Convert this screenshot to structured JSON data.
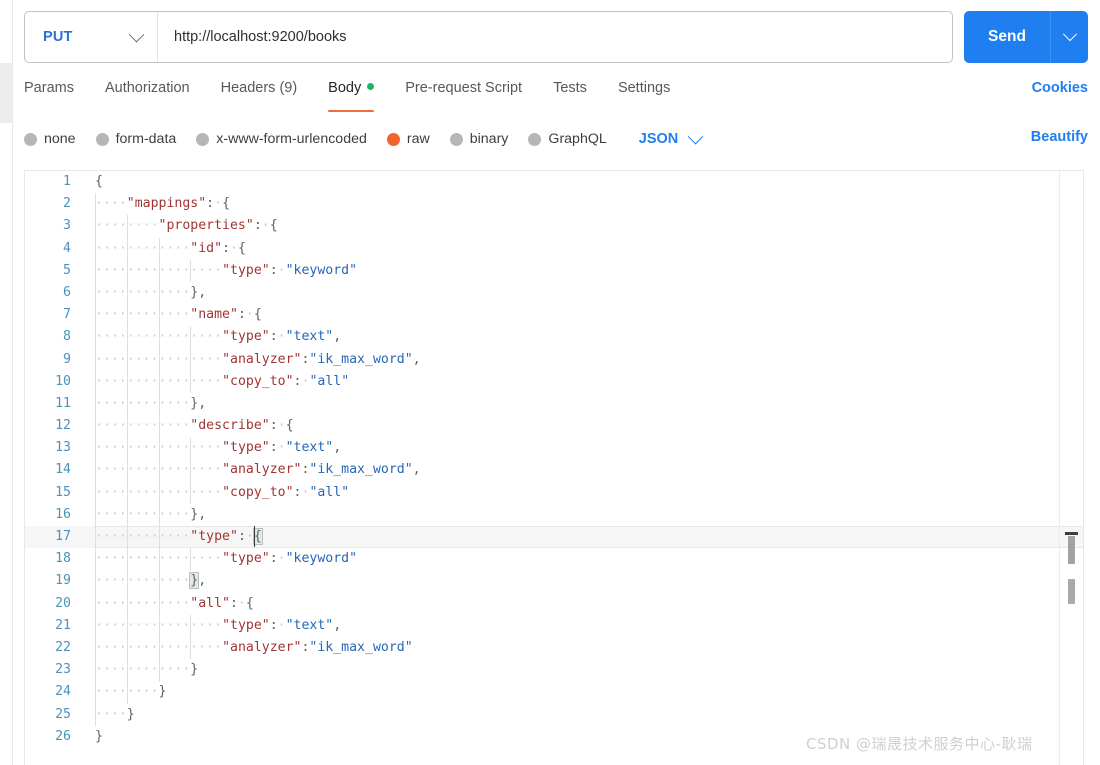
{
  "request": {
    "method": "PUT",
    "url": "http://localhost:9200/books",
    "send_label": "Send"
  },
  "tabs": [
    {
      "label": "Params",
      "active": false,
      "dot": false
    },
    {
      "label": "Authorization",
      "active": false,
      "dot": false
    },
    {
      "label": "Headers (9)",
      "active": false,
      "dot": false
    },
    {
      "label": "Body",
      "active": true,
      "dot": true
    },
    {
      "label": "Pre-request Script",
      "active": false,
      "dot": false
    },
    {
      "label": "Tests",
      "active": false,
      "dot": false
    },
    {
      "label": "Settings",
      "active": false,
      "dot": false
    }
  ],
  "cookies_label": "Cookies",
  "body_types": [
    {
      "label": "none",
      "selected": false
    },
    {
      "label": "form-data",
      "selected": false
    },
    {
      "label": "x-www-form-urlencoded",
      "selected": false
    },
    {
      "label": "raw",
      "selected": true
    },
    {
      "label": "binary",
      "selected": false
    },
    {
      "label": "GraphQL",
      "selected": false
    }
  ],
  "format": "JSON",
  "beautify_label": "Beautify",
  "colors": {
    "accent_blue": "#1f7ef0",
    "tab_underline": "#f26b3a",
    "body_dot_green": "#1cb561",
    "raw_radio": "#f1642e",
    "json_key": "#a03535",
    "json_string": "#2667b8",
    "line_number": "#4d92b8"
  },
  "editor": {
    "active_line": 17,
    "lines": [
      {
        "n": 1,
        "indent": 0,
        "tokens": [
          {
            "t": "p",
            "v": "{"
          }
        ]
      },
      {
        "n": 2,
        "indent": 1,
        "tokens": [
          {
            "t": "k",
            "v": "\"mappings\""
          },
          {
            "t": "p",
            "v": ":"
          },
          {
            "t": "ws",
            "v": "·"
          },
          {
            "t": "p",
            "v": "{"
          }
        ]
      },
      {
        "n": 3,
        "indent": 2,
        "tokens": [
          {
            "t": "k",
            "v": "\"properties\""
          },
          {
            "t": "p",
            "v": ":"
          },
          {
            "t": "ws",
            "v": "·"
          },
          {
            "t": "p",
            "v": "{"
          }
        ]
      },
      {
        "n": 4,
        "indent": 3,
        "tokens": [
          {
            "t": "k",
            "v": "\"id\""
          },
          {
            "t": "p",
            "v": ":"
          },
          {
            "t": "ws",
            "v": "·"
          },
          {
            "t": "p",
            "v": "{"
          }
        ]
      },
      {
        "n": 5,
        "indent": 4,
        "tokens": [
          {
            "t": "k",
            "v": "\"type\""
          },
          {
            "t": "p",
            "v": ":"
          },
          {
            "t": "ws",
            "v": "·"
          },
          {
            "t": "s",
            "v": "\"keyword\""
          }
        ]
      },
      {
        "n": 6,
        "indent": 3,
        "tokens": [
          {
            "t": "p",
            "v": "},"
          }
        ]
      },
      {
        "n": 7,
        "indent": 3,
        "tokens": [
          {
            "t": "k",
            "v": "\"name\""
          },
          {
            "t": "p",
            "v": ":"
          },
          {
            "t": "ws",
            "v": "·"
          },
          {
            "t": "p",
            "v": "{"
          }
        ]
      },
      {
        "n": 8,
        "indent": 4,
        "tokens": [
          {
            "t": "k",
            "v": "\"type\""
          },
          {
            "t": "p",
            "v": ":"
          },
          {
            "t": "ws",
            "v": "·"
          },
          {
            "t": "s",
            "v": "\"text\""
          },
          {
            "t": "p",
            "v": ","
          }
        ]
      },
      {
        "n": 9,
        "indent": 4,
        "tokens": [
          {
            "t": "k",
            "v": "\"analyzer\""
          },
          {
            "t": "p",
            "v": ":"
          },
          {
            "t": "s",
            "v": "\"ik_max_word\""
          },
          {
            "t": "p",
            "v": ","
          }
        ]
      },
      {
        "n": 10,
        "indent": 4,
        "tokens": [
          {
            "t": "k",
            "v": "\"copy_to\""
          },
          {
            "t": "p",
            "v": ":"
          },
          {
            "t": "ws",
            "v": "·"
          },
          {
            "t": "s",
            "v": "\"all\""
          }
        ]
      },
      {
        "n": 11,
        "indent": 3,
        "tokens": [
          {
            "t": "p",
            "v": "},"
          }
        ]
      },
      {
        "n": 12,
        "indent": 3,
        "tokens": [
          {
            "t": "k",
            "v": "\"describe\""
          },
          {
            "t": "p",
            "v": ":"
          },
          {
            "t": "ws",
            "v": "·"
          },
          {
            "t": "p",
            "v": "{"
          }
        ]
      },
      {
        "n": 13,
        "indent": 4,
        "tokens": [
          {
            "t": "k",
            "v": "\"type\""
          },
          {
            "t": "p",
            "v": ":"
          },
          {
            "t": "ws",
            "v": "·"
          },
          {
            "t": "s",
            "v": "\"text\""
          },
          {
            "t": "p",
            "v": ","
          }
        ]
      },
      {
        "n": 14,
        "indent": 4,
        "tokens": [
          {
            "t": "k",
            "v": "\"analyzer\""
          },
          {
            "t": "p",
            "v": ":"
          },
          {
            "t": "s",
            "v": "\"ik_max_word\""
          },
          {
            "t": "p",
            "v": ","
          }
        ]
      },
      {
        "n": 15,
        "indent": 4,
        "tokens": [
          {
            "t": "k",
            "v": "\"copy_to\""
          },
          {
            "t": "p",
            "v": ":"
          },
          {
            "t": "ws",
            "v": "·"
          },
          {
            "t": "s",
            "v": "\"all\""
          }
        ]
      },
      {
        "n": 16,
        "indent": 3,
        "tokens": [
          {
            "t": "p",
            "v": "},"
          }
        ]
      },
      {
        "n": 17,
        "indent": 3,
        "tokens": [
          {
            "t": "k",
            "v": "\"type\""
          },
          {
            "t": "p",
            "v": ":"
          },
          {
            "t": "ws",
            "v": "·"
          },
          {
            "t": "hl",
            "v": "{"
          }
        ]
      },
      {
        "n": 18,
        "indent": 4,
        "tokens": [
          {
            "t": "k",
            "v": "\"type\""
          },
          {
            "t": "p",
            "v": ":"
          },
          {
            "t": "ws",
            "v": "·"
          },
          {
            "t": "s",
            "v": "\"keyword\""
          }
        ]
      },
      {
        "n": 19,
        "indent": 3,
        "tokens": [
          {
            "t": "hl",
            "v": "}"
          },
          {
            "t": "p",
            "v": ","
          }
        ]
      },
      {
        "n": 20,
        "indent": 3,
        "tokens": [
          {
            "t": "k",
            "v": "\"all\""
          },
          {
            "t": "p",
            "v": ":"
          },
          {
            "t": "ws",
            "v": "·"
          },
          {
            "t": "p",
            "v": "{"
          }
        ]
      },
      {
        "n": 21,
        "indent": 4,
        "tokens": [
          {
            "t": "k",
            "v": "\"type\""
          },
          {
            "t": "p",
            "v": ":"
          },
          {
            "t": "ws",
            "v": "·"
          },
          {
            "t": "s",
            "v": "\"text\""
          },
          {
            "t": "p",
            "v": ","
          }
        ]
      },
      {
        "n": 22,
        "indent": 4,
        "tokens": [
          {
            "t": "k",
            "v": "\"analyzer\""
          },
          {
            "t": "p",
            "v": ":"
          },
          {
            "t": "s",
            "v": "\"ik_max_word\""
          }
        ]
      },
      {
        "n": 23,
        "indent": 3,
        "tokens": [
          {
            "t": "p",
            "v": "}"
          }
        ]
      },
      {
        "n": 24,
        "indent": 2,
        "tokens": [
          {
            "t": "p",
            "v": "}"
          }
        ]
      },
      {
        "n": 25,
        "indent": 1,
        "tokens": [
          {
            "t": "p",
            "v": "}"
          }
        ]
      },
      {
        "n": 26,
        "indent": 0,
        "tokens": [
          {
            "t": "p",
            "v": "}"
          }
        ]
      }
    ]
  },
  "watermark": "CSDN @瑞晟技术服务中心-耿瑞"
}
